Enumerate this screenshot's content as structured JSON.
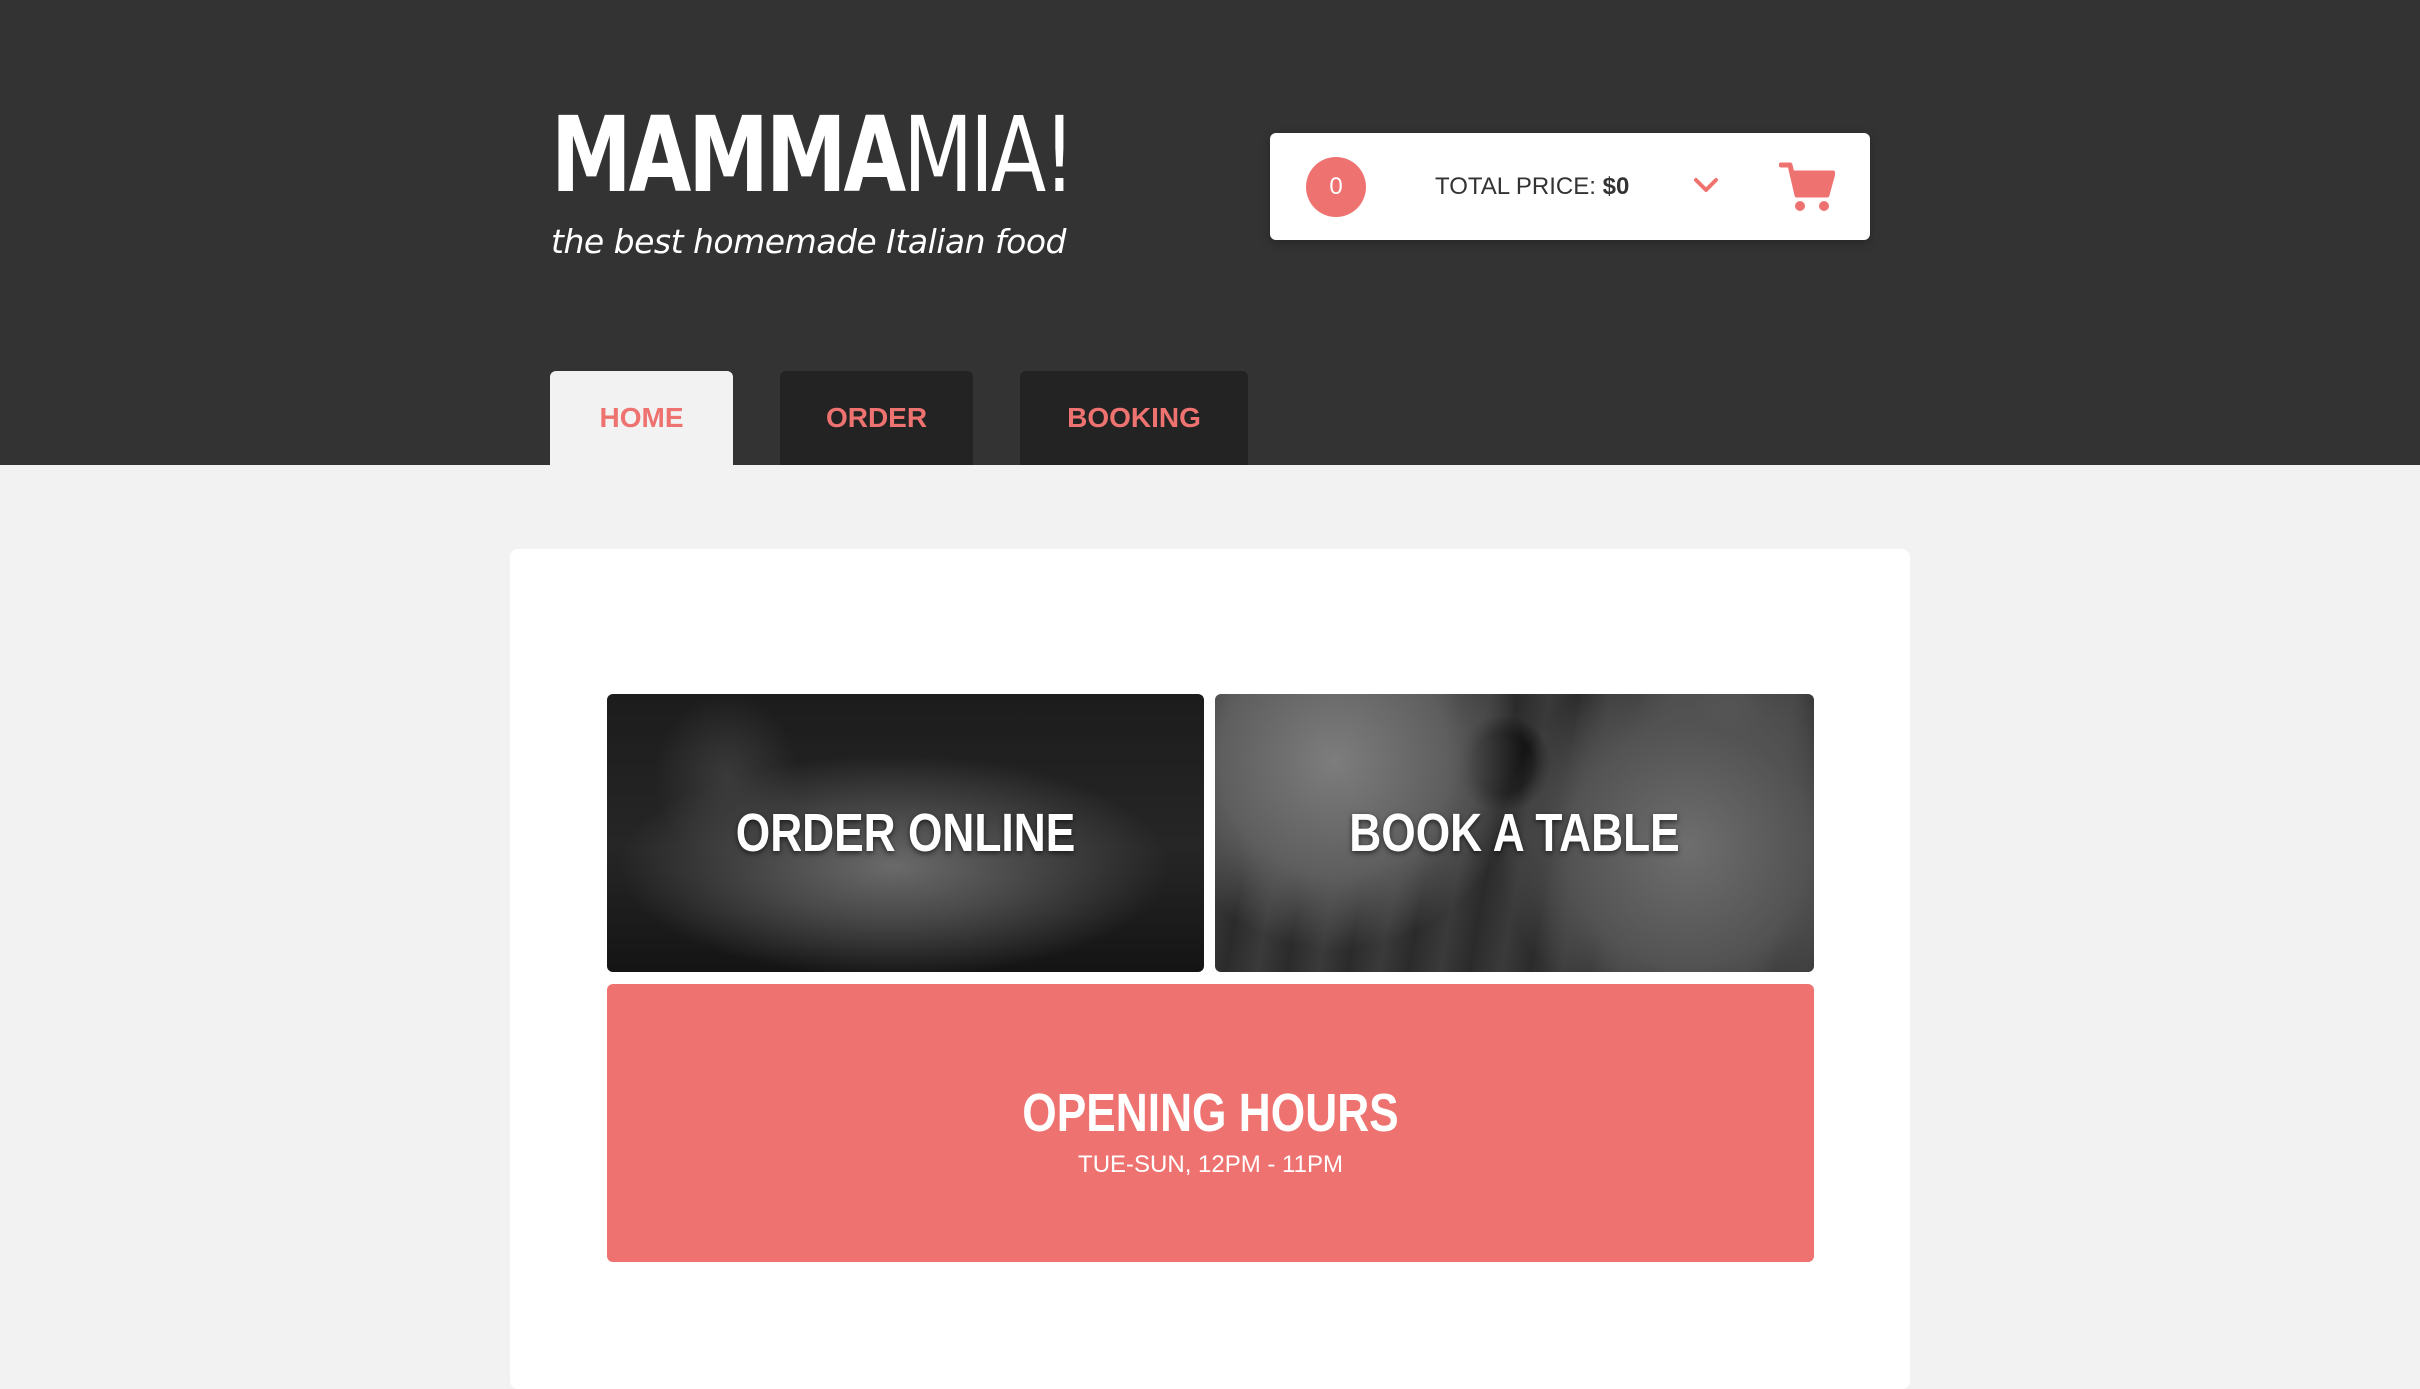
{
  "brand": {
    "logo_bold": "MAMMA",
    "logo_light": "MIA!",
    "tagline": "the best homemade Italian food"
  },
  "cart": {
    "count": "0",
    "total_label": "TOTAL PRICE: ",
    "total_value": "$0",
    "icons": {
      "chevron": "chevron-down-icon",
      "cart": "shopping-cart-icon"
    }
  },
  "nav": {
    "tabs": [
      {
        "label": "HOME",
        "active": true
      },
      {
        "label": "ORDER",
        "active": false
      },
      {
        "label": "BOOKING",
        "active": false
      }
    ]
  },
  "tiles": {
    "order": {
      "label": "ORDER ONLINE"
    },
    "book": {
      "label": "BOOK A TABLE"
    },
    "hours": {
      "title": "OPENING HOURS",
      "time": "TUE-SUN, 12PM - 11PM"
    }
  },
  "colors": {
    "accent": "#ee7370",
    "header_bg": "#333333",
    "tab_bg": "#232323",
    "page_bg": "#f2f2f2",
    "panel_bg": "#ffffff"
  }
}
